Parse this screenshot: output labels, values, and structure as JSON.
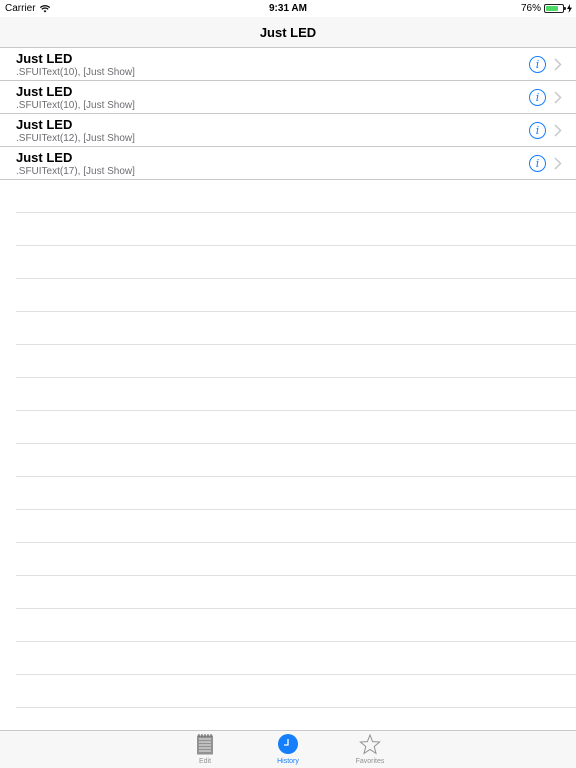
{
  "status_bar": {
    "carrier": "Carrier",
    "time": "9:31 AM",
    "battery": "76%",
    "battery_level": 0.76
  },
  "nav": {
    "title": "Just LED"
  },
  "rows": [
    {
      "title": "Just LED",
      "subtitle": ".SFUIText(10), [Just Show]"
    },
    {
      "title": "Just LED",
      "subtitle": ".SFUIText(10), [Just Show]"
    },
    {
      "title": "Just LED",
      "subtitle": ".SFUIText(12), [Just Show]"
    },
    {
      "title": "Just LED",
      "subtitle": ".SFUIText(17), [Just Show]"
    }
  ],
  "tabs": [
    {
      "label": "Edit",
      "icon": "notepad-icon",
      "active": false
    },
    {
      "label": "History",
      "icon": "clock-icon",
      "active": true
    },
    {
      "label": "Favorites",
      "icon": "star-icon",
      "active": false
    }
  ],
  "colors": {
    "accent": "#147efb",
    "battery_fill": "#4cd964",
    "inactive_tab": "#929292"
  }
}
